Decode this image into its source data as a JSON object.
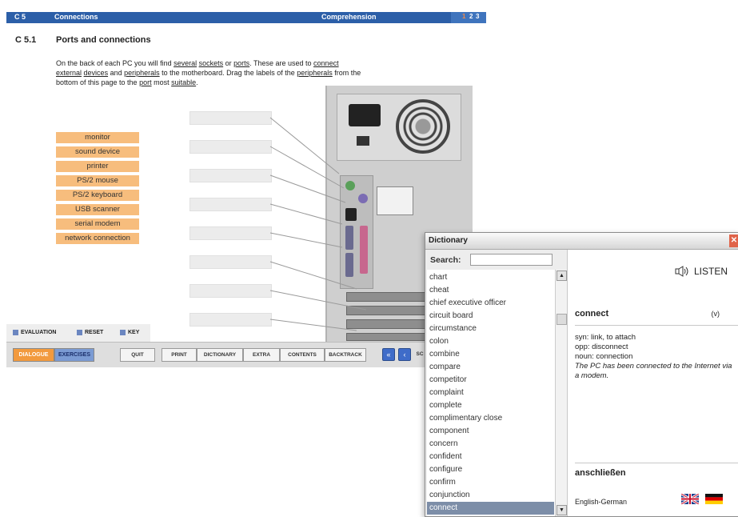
{
  "app": {
    "topbar": {
      "chapter": "C 5",
      "section": "Connections",
      "mode": "Comprehension",
      "pages": [
        "1",
        "2",
        "3"
      ],
      "active_page": "1"
    },
    "section_number": "C 5.1",
    "section_title": "Ports and connections",
    "instructions": {
      "line1_parts": [
        "On the back of each PC you will find ",
        "several",
        " ",
        "sockets",
        " or ",
        "ports",
        ". These are used to ",
        "connect"
      ],
      "line2_parts": [
        "external",
        " ",
        "devices",
        " and ",
        "peripherals",
        " to the motherboard. Drag the labels of the ",
        "peripherals",
        " from the"
      ],
      "line3_parts": [
        "bottom of this page to the ",
        "port",
        " most ",
        "suitable",
        "."
      ]
    },
    "labels": [
      "monitor",
      "sound device",
      "printer",
      "PS/2 mouse",
      "PS/2 keyboard",
      "USB scanner",
      "serial modem",
      "network connection"
    ],
    "eval_bar": {
      "evaluation": "EVALUATION",
      "reset": "RESET",
      "key": "KEY"
    },
    "nav_bar": {
      "dialogue": "DIALOGUE",
      "exercises": "EXERCISES",
      "buttons": [
        "QUIT",
        "PRINT",
        "DICTIONARY",
        "EXTRA",
        "CONTENTS",
        "BACKTRACK"
      ],
      "prev_all": "«",
      "prev": "‹",
      "trailing": "SC"
    }
  },
  "dictionary": {
    "title": "Dictionary",
    "close": "✕",
    "search_label": "Search:",
    "search_value": "",
    "words": [
      "chart",
      "cheat",
      "chief executive officer",
      "circuit board",
      "circumstance",
      "colon",
      "combine",
      "compare",
      "competitor",
      "complaint",
      "complete",
      "complimentary close",
      "component",
      "concern",
      "confident",
      "configure",
      "confirm",
      "conjunction",
      "connect"
    ],
    "selected_word": "connect",
    "listen": "LISTEN",
    "entry": {
      "word": "connect",
      "pos": "(v)",
      "syn": "syn: link, to attach",
      "opp": "opp: disconnect",
      "noun": "noun: connection",
      "example": "The PC has been connected to the Internet via a modem."
    },
    "translation": "anschließen",
    "language_pair": "English-German",
    "icons": {
      "speaker": "speaker-icon",
      "flag_en": "uk-flag-icon",
      "flag_de": "german-flag-icon"
    }
  },
  "colors": {
    "topbar": "#2c5fa8",
    "label_bg": "#f7bd7d",
    "dialogue": "#f29a3e",
    "exercises": "#7b9bd3",
    "selected_word_bg": "#7d8ea8"
  }
}
